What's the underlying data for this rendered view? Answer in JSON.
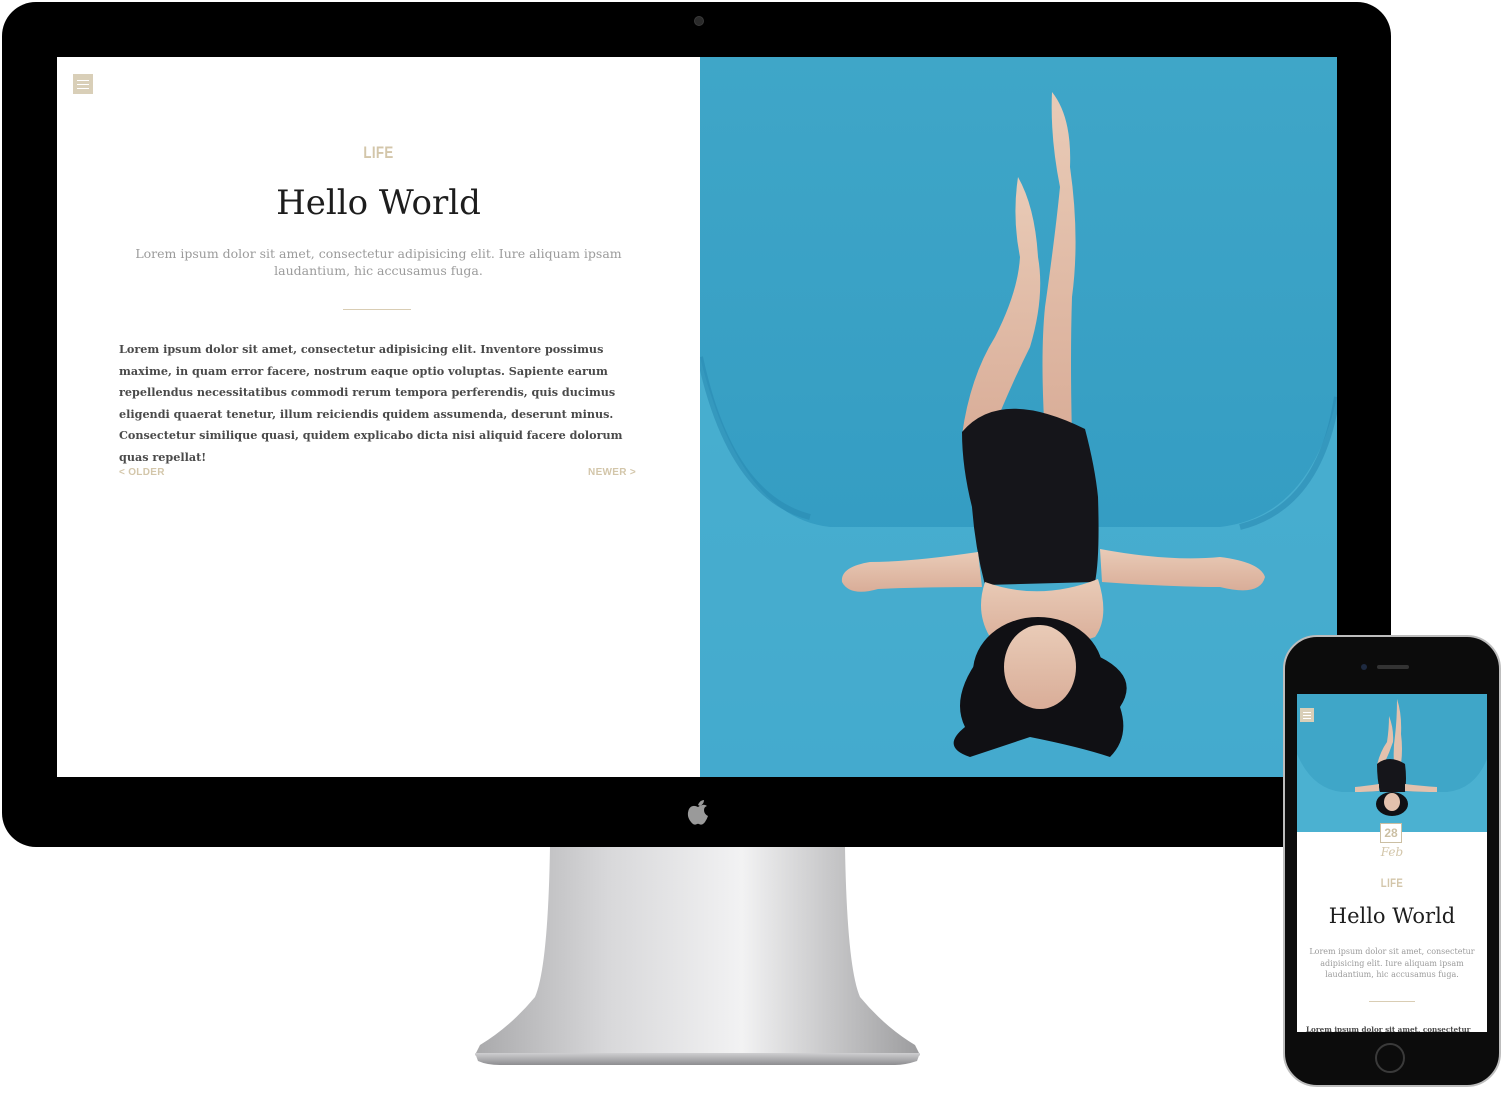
{
  "desktop": {
    "menu_icon": "hamburger-menu-icon",
    "category": "LIFE",
    "title": "Hello World",
    "subtitle": "Lorem ipsum dolor sit amet, consectetur adipisicing elit. Iure aliquam ipsam laudantium, hic accusamus fuga.",
    "body": "Lorem ipsum dolor sit amet, consectetur adipisicing elit. Inventore possimus maxime, in quam error facere, nostrum eaque optio voluptas. Sapiente earum repellendus necessitatibus commodi rerum tempora perferendis, quis ducimus eligendi quaerat tenetur, illum reiciendis quidem assumenda, deserunt minus. Consectetur similique quasi, quidem explicabo dicta nisi aliquid facere dolorum quas repellat!",
    "pager": {
      "older": "< OLDER",
      "newer": "NEWER >"
    }
  },
  "mobile": {
    "menu_icon": "hamburger-menu-icon",
    "date_day": "28",
    "date_month": "Feb",
    "category": "LIFE",
    "title": "Hello World",
    "subtitle": "Lorem ipsum dolor sit amet, consectetur adipisicing elit. Iure aliquam ipsam laudantium, hic accusamus fuga.",
    "body_preview": "Lorem ipsum dolor sit amet, consectetur"
  },
  "colors": {
    "accent": "#d3c6aa",
    "pool_blue": "#3fa8c9",
    "device_black": "#000000"
  },
  "icons": {
    "monitor_logo": "apple-logo-icon"
  }
}
